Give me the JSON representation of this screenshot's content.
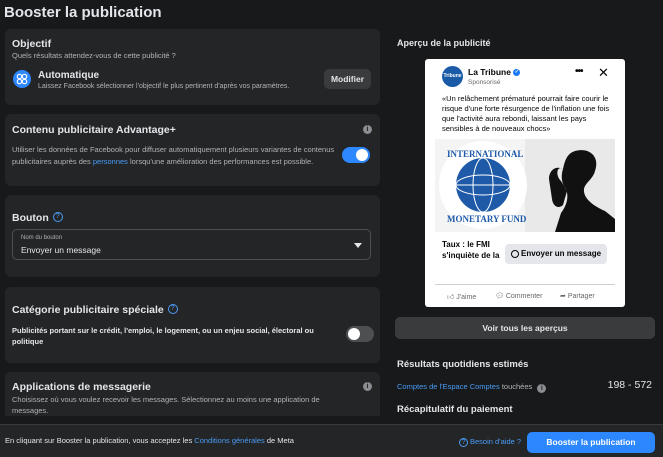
{
  "page_title": "Booster la publication",
  "objectif": {
    "title": "Objectif",
    "subtitle": "Quels résultats attendez-vous de cette publicité ?",
    "option_label": "Automatique",
    "option_desc": "Laissez Facebook sélectionner l'objectif le plus pertinent d'après vos paramètres.",
    "modify_label": "Modifier"
  },
  "advantage": {
    "title": "Contenu publicitaire Advantage+",
    "desc_before": "Utiliser les données de Facebook pour diffuser automatiquement plusieurs variantes de contenus publicitaires auprès des",
    "desc_link": "personnes",
    "desc_after": "lorsqu'une amélioration des performances est possible.",
    "toggle_on": true
  },
  "bouton": {
    "title": "Bouton",
    "select_label": "Nom du bouton",
    "select_value": "Envoyer un message"
  },
  "categorie": {
    "title": "Catégorie publicitaire spéciale",
    "desc": "Publicités portant sur le crédit, l'emploi, le logement, ou un enjeu social, électoral ou politique",
    "toggle_on": false
  },
  "messagerie": {
    "title": "Applications de messagerie",
    "desc": "Choisissez où vous voulez recevoir les messages. Sélectionnez au moins une application de messages."
  },
  "preview": {
    "heading": "Aperçu de la publicité",
    "page_name": "La Tribune",
    "sponsored": "Sponsorisé",
    "logo_text": "Tribune",
    "post_text": "«Un relâchement prématuré pourrait faire courir le risque d'une forte résurgence de l'inflation une fois que l'activité aura rebondi, laissant les pays sensibles à de nouveaux chocs»",
    "seal_top": "INTERNATIONAL",
    "seal_bottom": "MONETARY FUND",
    "link_title": "Taux : le FMI s'inquiète de la",
    "cta": "Envoyer un message",
    "like": "J'aime",
    "comment": "Commenter",
    "share": "Partager",
    "all_previews": "Voir tous les aperçus"
  },
  "results": {
    "title": "Résultats quotidiens estimés",
    "metric_link": "Comptes de l'Espace Comptes",
    "metric_suffix": "touchées",
    "value": "198 - 572"
  },
  "payment": {
    "title": "Récapitulatif du paiement"
  },
  "footer": {
    "terms_before": "En cliquant sur Booster la publication, vous acceptez les",
    "terms_link": "Conditions générales",
    "terms_after": "de Meta",
    "help": "Besoin d'aide ?",
    "boost_button": "Booster la publication"
  },
  "colors": {
    "background": "#18191a",
    "card": "#242526",
    "accent": "#2d88ff",
    "link": "#4a9cf7",
    "toggle_off": "#4e4f50"
  }
}
